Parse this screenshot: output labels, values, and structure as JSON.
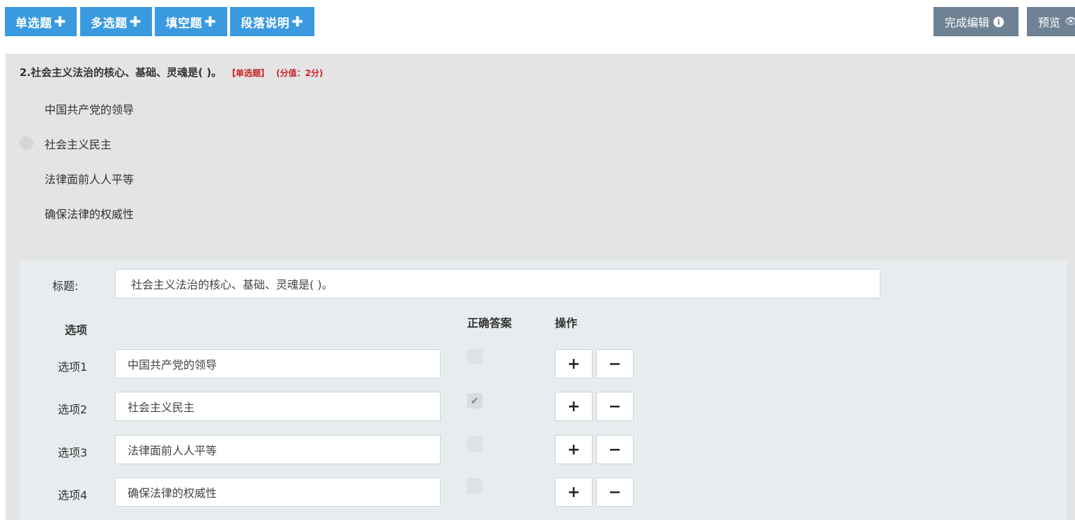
{
  "toolbar": {
    "single_choice": "单选题",
    "multi_choice": "多选题",
    "fill_blank": "填空题",
    "paragraph": "段落说明",
    "plus": "✚",
    "finish_edit": "完成编辑",
    "info_glyph": "i",
    "preview": "预览",
    "eye_glyph": "👁"
  },
  "question": {
    "title": "2.社会主义法治的核心、基础、灵魂是( )。",
    "type_tag": "【单选题】",
    "score_tag": "(分值：2分)",
    "options": [
      "中国共产党的领导",
      "社会主义民主",
      "法律面前人人平等",
      "确保法律的权威性"
    ]
  },
  "editor": {
    "title_label": "标题:",
    "title_value": "社会主义法治的核心、基础、灵魂是( )。",
    "options_header": "选项",
    "correct_header": "正确答案",
    "actions_header": "操作",
    "rows": [
      {
        "label": "选项1",
        "value": "中国共产党的领导",
        "correct": false
      },
      {
        "label": "选项2",
        "value": "社会主义民主",
        "correct": true
      },
      {
        "label": "选项3",
        "value": "法律面前人人平等",
        "correct": false
      },
      {
        "label": "选项4",
        "value": "确保法律的权威性",
        "correct": false
      }
    ],
    "check_glyph": "✔",
    "add_glyph": "+",
    "remove_glyph": "−"
  },
  "colors": {
    "primary": "#3a9ae0",
    "secondary": "#6f8294",
    "danger_text": "#cc2222"
  }
}
